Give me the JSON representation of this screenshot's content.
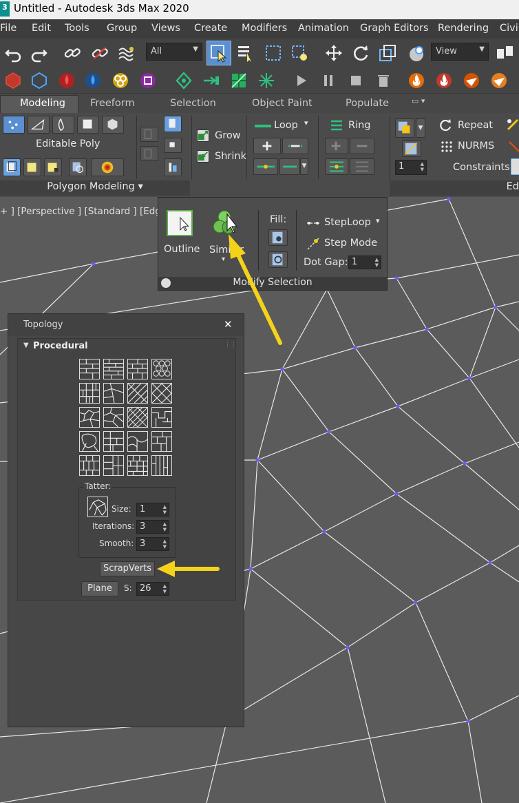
{
  "window": {
    "title": "Untitled - Autodesk 3ds Max 2020",
    "logo_text": "3"
  },
  "menu": {
    "items": [
      "File",
      "Edit",
      "Tools",
      "Group",
      "Views",
      "Create",
      "Modifiers",
      "Animation",
      "Graph Editors",
      "Rendering",
      "Civil"
    ]
  },
  "toolbar": {
    "selection_filter": "All",
    "view_dropdown": "View"
  },
  "ribbon": {
    "tabs": [
      "Modeling",
      "Freeform",
      "Selection",
      "Object Paint",
      "Populate"
    ],
    "active_tab": "Modeling",
    "polygon_modeling": {
      "object_label": "Editable Poly",
      "footer": "Polygon Modeling"
    },
    "modify_selection": {
      "grow": "Grow",
      "shrink": "Shrink",
      "loop": "Loop",
      "ring": "Ring"
    },
    "subdivision": {
      "repeat": "Repeat",
      "nurms": "NURMS",
      "constraints": "Constraints:",
      "iterations_value": "1",
      "footer_partial": "Ed"
    }
  },
  "viewport": {
    "label": "+ ] [Perspective ] [Standard ] [Edged"
  },
  "flyout": {
    "outline": "Outline",
    "similar": "Similar",
    "fill": "Fill:",
    "steploop": "StepLoop",
    "step_mode": "Step Mode",
    "dot_gap_label": "Dot Gap:",
    "dot_gap_value": "1",
    "footer": "Modify Selection"
  },
  "topology": {
    "title": "Topology",
    "close": "✕",
    "rollout": "Procedural",
    "tatter": {
      "group": "Tatter:",
      "size_label": "Size:",
      "size_value": "1",
      "iterations_label": "Iterations:",
      "iterations_value": "3",
      "smooth_label": "Smooth:",
      "smooth_value": "3"
    },
    "scrapverts": "ScrapVerts",
    "plane": "Plane",
    "s_label": "S:",
    "s_value": "26"
  },
  "colors": {
    "highlight_arrow": "#f5d21a",
    "active_tool": "#5a8fd0",
    "vertex": "#6a5cff"
  }
}
